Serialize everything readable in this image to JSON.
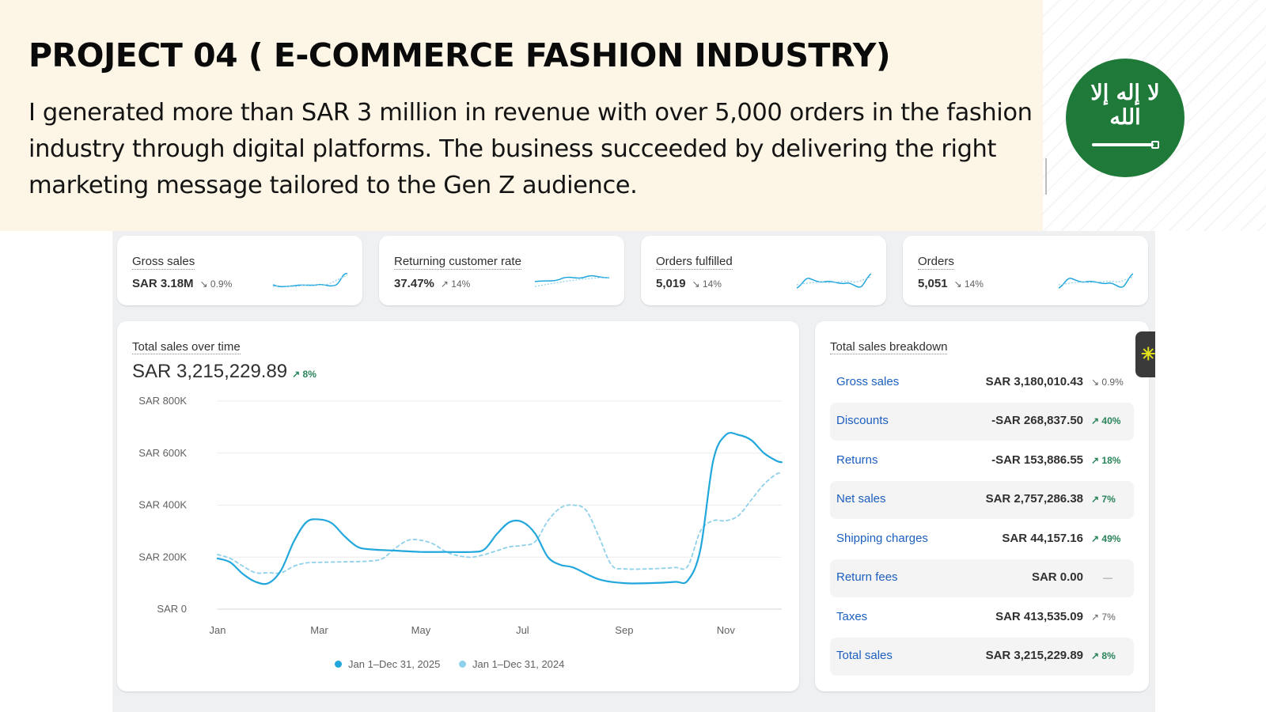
{
  "hero": {
    "title": "PROJECT 04 ( E-COMMERCE FASHION  INDUSTRY)",
    "description": "I generated more than SAR 3 million in revenue with over 5,000 orders in the fashion industry through digital platforms. The business succeeded by delivering the right marketing message tailored to the Gen Z audience."
  },
  "kpis": [
    {
      "label": "Gross sales",
      "value": "SAR 3.18M",
      "delta": "↘ 0.9%",
      "trend": "down"
    },
    {
      "label": "Returning customer rate",
      "value": "37.47%",
      "delta": "↗ 14%",
      "trend": "up"
    },
    {
      "label": "Orders fulfilled",
      "value": "5,019",
      "delta": "↘ 14%",
      "trend": "down"
    },
    {
      "label": "Orders",
      "value": "5,051",
      "delta": "↘ 14%",
      "trend": "down"
    }
  ],
  "sales_over_time": {
    "title": "Total sales over time",
    "total": "SAR 3,215,229.89",
    "delta": "↗ 8%",
    "legend": [
      "Jan 1–Dec 31, 2025",
      "Jan 1–Dec 31, 2024"
    ]
  },
  "chart_data": {
    "type": "line",
    "y_tick_labels": [
      "SAR 0",
      "SAR 200K",
      "SAR 400K",
      "SAR 600K",
      "SAR 800K"
    ],
    "y_ticks": [
      0,
      200000,
      400000,
      600000,
      800000
    ],
    "x_tick_labels": [
      "Jan",
      "Mar",
      "May",
      "Jul",
      "Sep",
      "Nov"
    ],
    "x_ticks": [
      0,
      2,
      4,
      6,
      8,
      10
    ],
    "ylim": [
      0,
      800000
    ],
    "xlim": [
      0,
      11.1
    ],
    "grid": true,
    "legend_position": "bottom",
    "series": [
      {
        "name": "Jan 1–Dec 31, 2025",
        "color": "#22a7dc",
        "style": "solid",
        "x": [
          0,
          0.25,
          0.5,
          0.75,
          1,
          1.25,
          1.5,
          1.75,
          2,
          2.25,
          2.5,
          2.75,
          3,
          3.5,
          4,
          4.5,
          5,
          5.25,
          5.5,
          5.75,
          6,
          6.25,
          6.5,
          6.75,
          7,
          7.5,
          8,
          8.5,
          9,
          9.25,
          9.5,
          9.75,
          10,
          10.25,
          10.5,
          10.75,
          11,
          11.1
        ],
        "y": [
          195000,
          180000,
          135000,
          105000,
          100000,
          150000,
          260000,
          335000,
          345000,
          330000,
          280000,
          240000,
          230000,
          225000,
          220000,
          220000,
          220000,
          230000,
          290000,
          335000,
          335000,
          290000,
          200000,
          170000,
          160000,
          115000,
          100000,
          100000,
          105000,
          110000,
          230000,
          570000,
          670000,
          670000,
          650000,
          600000,
          570000,
          565000
        ]
      },
      {
        "name": "Jan 1–Dec 31, 2024",
        "color": "#8fd0ea",
        "style": "dashed",
        "x": [
          0,
          0.25,
          0.5,
          0.75,
          1,
          1.25,
          1.5,
          1.75,
          2,
          2.5,
          3,
          3.25,
          3.5,
          3.75,
          4,
          4.25,
          4.5,
          4.75,
          5,
          5.25,
          5.5,
          5.75,
          6,
          6.25,
          6.5,
          6.75,
          7,
          7.25,
          7.5,
          7.75,
          8,
          8.5,
          9,
          9.25,
          9.5,
          9.75,
          10,
          10.25,
          10.5,
          10.75,
          11,
          11.1
        ],
        "y": [
          210000,
          195000,
          165000,
          140000,
          140000,
          140000,
          165000,
          178000,
          180000,
          182000,
          185000,
          195000,
          235000,
          265000,
          265000,
          250000,
          220000,
          205000,
          200000,
          210000,
          225000,
          240000,
          245000,
          260000,
          340000,
          390000,
          400000,
          380000,
          280000,
          170000,
          155000,
          155000,
          160000,
          165000,
          300000,
          340000,
          340000,
          360000,
          420000,
          480000,
          520000,
          520000
        ]
      }
    ]
  },
  "breakdown": {
    "title": "Total sales breakdown",
    "rows": [
      {
        "label": "Gross sales",
        "amount": "SAR 3,180,010.43",
        "delta": "↘ 0.9%",
        "trend": "down"
      },
      {
        "label": "Discounts",
        "amount": "-SAR 268,837.50",
        "delta": "↗ 40%",
        "trend": "up"
      },
      {
        "label": "Returns",
        "amount": "-SAR 153,886.55",
        "delta": "↗ 18%",
        "trend": "up"
      },
      {
        "label": "Net sales",
        "amount": "SAR 2,757,286.38",
        "delta": "↗ 7%",
        "trend": "up"
      },
      {
        "label": "Shipping charges",
        "amount": "SAR 44,157.16",
        "delta": "↗ 49%",
        "trend": "up"
      },
      {
        "label": "Return fees",
        "amount": "SAR 0.00",
        "delta": "—",
        "trend": "flat"
      },
      {
        "label": "Taxes",
        "amount": "SAR 413,535.09",
        "delta": "↗ 7%",
        "trend": "down"
      },
      {
        "label": "Total sales",
        "amount": "SAR 3,215,229.89",
        "delta": "↗ 8%",
        "trend": "up"
      }
    ]
  },
  "flag": {
    "script": "لا إله إلا الله",
    "color": "#1f7a3a"
  },
  "colors": {
    "accent_blue": "#22a7dc",
    "positive": "#29845a",
    "link": "#1c5fbf",
    "hero_bg": "#fdf6e6"
  }
}
